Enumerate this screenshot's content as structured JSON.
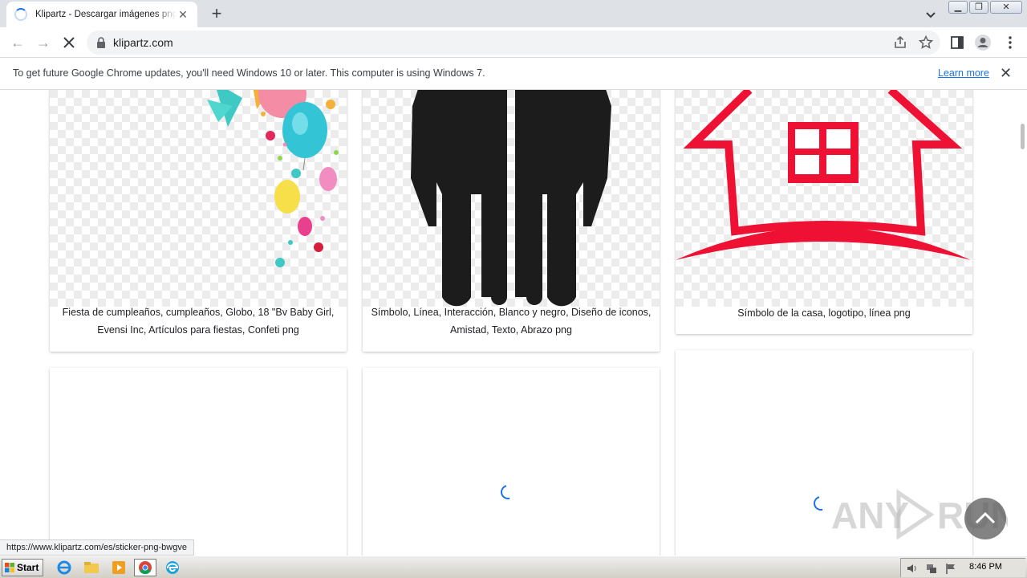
{
  "browser": {
    "tab_title": "Klipartz - Descargar imágenes png de alta calidad",
    "url": "klipartz.com",
    "window_buttons": [
      "minimize",
      "restore",
      "close"
    ]
  },
  "infobar": {
    "message": "To get future Google Chrome updates, you'll need Windows 10 or later. This computer is using Windows 7.",
    "link": "Learn more"
  },
  "cards": [
    {
      "caption": "Fiesta de cumpleaños, cumpleaños, Globo, 18 \"Bv Baby Girl, Evensi Inc, Artículos para fiestas, Confeti png",
      "image": "party-balloons-image"
    },
    {
      "caption": "Símbolo, Línea, Interacción, Blanco y negro, Diseño de iconos, Amistad, Texto, Abrazo png",
      "image": "friendship-figures-image"
    },
    {
      "caption": "Símbolo de la casa, logotipo, línea png",
      "image": "house-logo-image"
    }
  ],
  "status_bar_url": "https://www.klipartz.com/es/sticker-png-bwgve",
  "watermark": "ANY RUN",
  "taskbar": {
    "start_label": "Start",
    "clock": "8:46 PM",
    "apps": [
      "internet-explorer-icon",
      "file-explorer-icon",
      "media-player-icon",
      "chrome-icon",
      "edge-icon"
    ]
  },
  "colors": {
    "accent": "#1a73e8",
    "house_red": "#ee1133",
    "figure_black": "#1c1c1c"
  }
}
